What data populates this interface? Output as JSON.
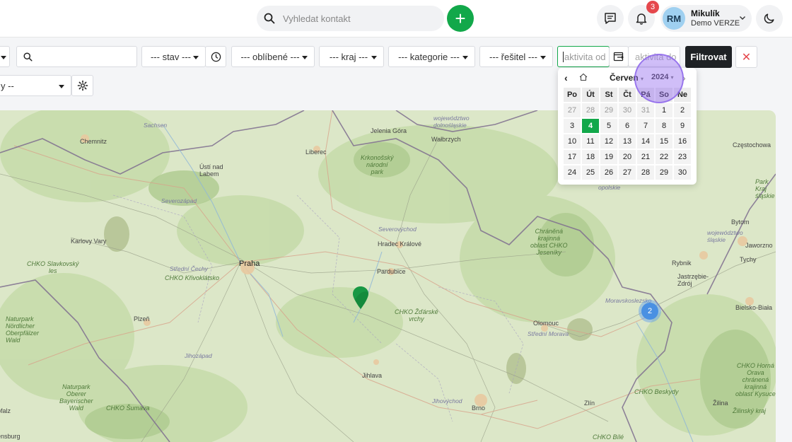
{
  "header": {
    "search_placeholder": "Vyhledat kontakt",
    "add_label": "+",
    "notifications_count": "3",
    "user": {
      "initials": "RM",
      "name": "Mikulík",
      "org": "Demo VERZE"
    }
  },
  "filters": {
    "stav": "--- stav ---",
    "oblibene": "--- oblíbené ---",
    "kraj": "--- kraj ---",
    "kategorie": "--- kategorie ---",
    "resitel": "--- řešitel ---",
    "activity_from_placeholder": "aktivita od",
    "activity_to_placeholder": "aktivita do",
    "filter_button": "Filtrovat",
    "clear_button": "✕",
    "second_select": "y --"
  },
  "calendar": {
    "month": "Červen",
    "year": "2024",
    "weekdays": [
      "Po",
      "Út",
      "St",
      "Čt",
      "Pá",
      "So",
      "Ne"
    ],
    "days": [
      [
        "27",
        "28",
        "29",
        "30",
        "31",
        "1",
        "2"
      ],
      [
        "3",
        "4",
        "5",
        "6",
        "7",
        "8",
        "9"
      ],
      [
        "10",
        "11",
        "12",
        "13",
        "14",
        "15",
        "16"
      ],
      [
        "17",
        "18",
        "19",
        "20",
        "21",
        "22",
        "23"
      ],
      [
        "24",
        "25",
        "26",
        "27",
        "28",
        "29",
        "30"
      ]
    ],
    "selected_day": "4"
  },
  "map": {
    "cluster_count": "2",
    "places": {
      "praha": "Praha",
      "pardubice": "Pardubice",
      "hradec": "Hradec Králové",
      "liberec": "Liberec",
      "chemnitz": "Chemnitz",
      "usti": "Ústí nad\nLabem",
      "karlovy": "Karlovy Vary",
      "plzen": "Plzeň",
      "jihlava": "Jihlava",
      "brno": "Brno",
      "olomouc": "Olomouc",
      "zlin": "Zlín",
      "zilina": "Žilina",
      "jelenia": "Jelenia Góra",
      "walbrzych": "Wałbrzych",
      "bytom": "Bytom",
      "tychy": "Tychy",
      "rybnik": "Rybnik",
      "jastrzebie": "Jastrzębie-\nZdrój",
      "bielsko": "Bielsko-Biała",
      "jaworzno": "Jaworzno",
      "czestochowa": "Częstochowa",
      "opolskie": "opolskie",
      "sachsen": "Sachsen",
      "dolnoslaskie": "województwo\ndolnośląskie",
      "severozapad": "Severozápad",
      "severovychod": "Severovýchod",
      "stredni_cechy": "Střední Čechy",
      "jihozapad": "Jihozápad",
      "jihovychod": "Jihovýchod",
      "stredni_morava": "Střední Morava",
      "moravskoslezsko": "Moravskoslezsko",
      "slaskie": "województwo\nśląskie",
      "krkonose": "Krkonošský\nnárodní\npark",
      "chko_slavkovsky": "CHKO Slavkovský\nles",
      "chko_krivoklatsko": "CHKO Křivoklátsko",
      "chko_zdarske": "CHKO Žďárské\nvrchy",
      "chko_jeseniky": "Chráněná\nkrajinná\noblast CHKO\nJeseníky",
      "chko_beskydy": "CHKO Beskydy",
      "chko_horna": "CHKO Horná\nOrava\nchránená\nkrajinná\noblasť Kysuce",
      "chko_sumava": "CHKO Šumava",
      "chko_bile": "CHKO Bílé",
      "naturpark_ober": "Naturpark\nNördlicher\nOberpfälzer\nWald",
      "naturpark_bay": "Naturpark\nOberer\nBayerischer\nWald",
      "zilinsky": "Žilinský kraj",
      "park_landscape": "Park\nKraj\nśląskie",
      "ensburg": "ensburg",
      "pfalz": "pfalz"
    }
  },
  "colors": {
    "accent": "#12a84a",
    "danger": "#e5484d",
    "dark": "#1f2225"
  }
}
